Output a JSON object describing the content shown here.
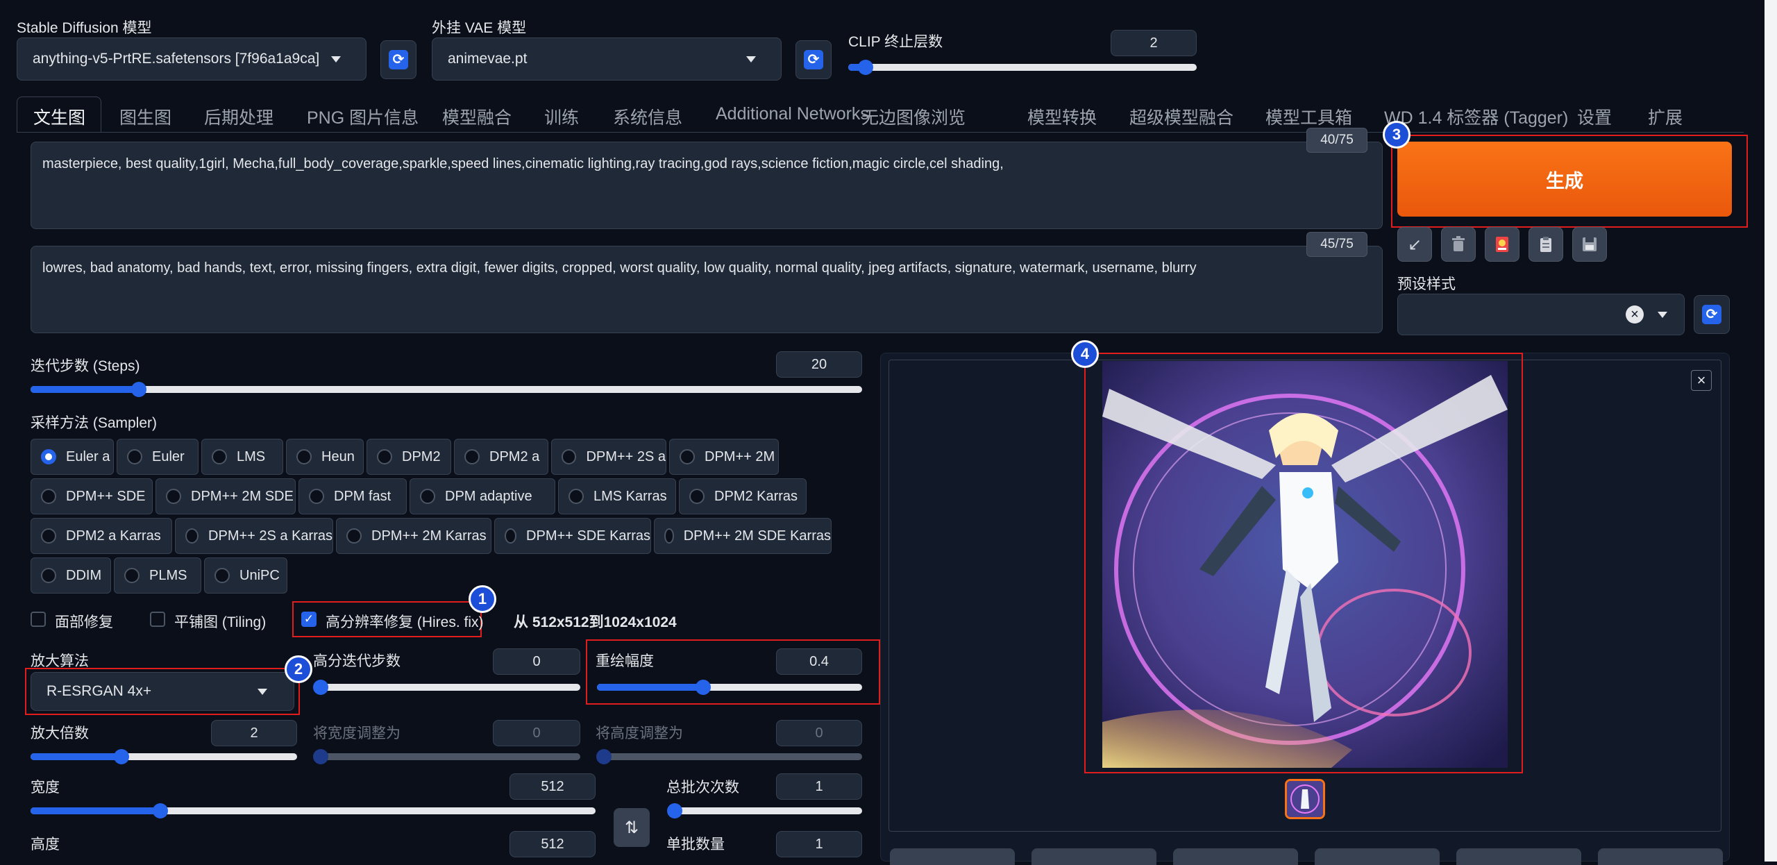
{
  "top": {
    "sd_model": {
      "label": "Stable Diffusion 模型",
      "value": "anything-v5-PrtRE.safetensors [7f96a1a9ca]"
    },
    "vae_model": {
      "label": "外挂 VAE 模型",
      "value": "animevae.pt"
    },
    "clip": {
      "label": "CLIP 终止层数",
      "value": "2",
      "fraction": 0.05
    }
  },
  "tabs": [
    {
      "label": "文生图",
      "active": true
    },
    {
      "label": "图生图"
    },
    {
      "label": "后期处理"
    },
    {
      "label": "PNG 图片信息"
    },
    {
      "label": "模型融合"
    },
    {
      "label": "训练"
    },
    {
      "label": "系统信息"
    },
    {
      "label": "Additional Networks"
    },
    {
      "label": "无边图像浏览"
    },
    {
      "label": "模型转换"
    },
    {
      "label": "超级模型融合"
    },
    {
      "label": "模型工具箱"
    },
    {
      "label": "WD 1.4 标签器 (Tagger)"
    },
    {
      "label": "设置"
    },
    {
      "label": "扩展"
    }
  ],
  "prompt": {
    "positive": "masterpiece, best quality,1girl, Mecha,full_body_coverage,sparkle,speed lines,cinematic lighting,ray tracing,god rays,science fiction,magic circle,cel shading,",
    "positive_count": "40/75",
    "negative": "lowres, bad anatomy, bad hands, text, error, missing fingers, extra digit, fewer digits, cropped, worst quality, low quality, normal quality, jpeg artifacts, signature, watermark, username, blurry",
    "negative_count": "45/75"
  },
  "generate": {
    "label": "生成"
  },
  "styles": {
    "label": "预设样式",
    "clear": "×"
  },
  "steps": {
    "label": "迭代步数 (Steps)",
    "value": "20",
    "fraction": 0.13
  },
  "sampler": {
    "label": "采样方法 (Sampler)",
    "options": [
      "Euler a",
      "Euler",
      "LMS",
      "Heun",
      "DPM2",
      "DPM2 a",
      "DPM++ 2S a",
      "DPM++ 2M",
      "DPM++ SDE",
      "DPM++ 2M SDE",
      "DPM fast",
      "DPM adaptive",
      "LMS Karras",
      "DPM2 Karras",
      "DPM2 a Karras",
      "DPM++ 2S a Karras",
      "DPM++ 2M Karras",
      "DPM++ SDE Karras",
      "DPM++ 2M SDE Karras",
      "DDIM",
      "PLMS",
      "UniPC"
    ],
    "selected": "Euler a"
  },
  "checks": {
    "face_restore": "面部修复",
    "tiling": "平铺图 (Tiling)",
    "hires_fix": "高分辨率修复 (Hires. fix)",
    "hires_info": "从 512x512到1024x1024"
  },
  "upscaler": {
    "label": "放大算法",
    "value": "R-ESRGAN 4x+"
  },
  "hires_steps": {
    "label": "高分迭代步数",
    "value": "0",
    "fraction": 0.0
  },
  "denoise": {
    "label": "重绘幅度",
    "value": "0.4",
    "fraction": 0.4
  },
  "upscale_by": {
    "label": "放大倍数",
    "value": "2",
    "fraction": 0.34
  },
  "resize_w": {
    "label": "将宽度调整为",
    "value": "0",
    "fraction": 0.0
  },
  "resize_h": {
    "label": "将高度调整为",
    "value": "0",
    "fraction": 0.0
  },
  "width": {
    "label": "宽度",
    "value": "512",
    "fraction": 0.23
  },
  "height": {
    "label": "高度",
    "value": "512"
  },
  "batch_count": {
    "label": "总批次次数",
    "value": "1",
    "fraction": 0.0
  },
  "batch_size": {
    "label": "单批数量",
    "value": "1"
  },
  "swap": {
    "icon": "⇅"
  },
  "output": {
    "close": "×"
  },
  "badges": [
    "1",
    "2",
    "3",
    "4"
  ],
  "colors": {
    "accent": "#2563eb",
    "generate": "#f97316",
    "highlight": "#e11d1d",
    "bg": "#0b0f19"
  }
}
